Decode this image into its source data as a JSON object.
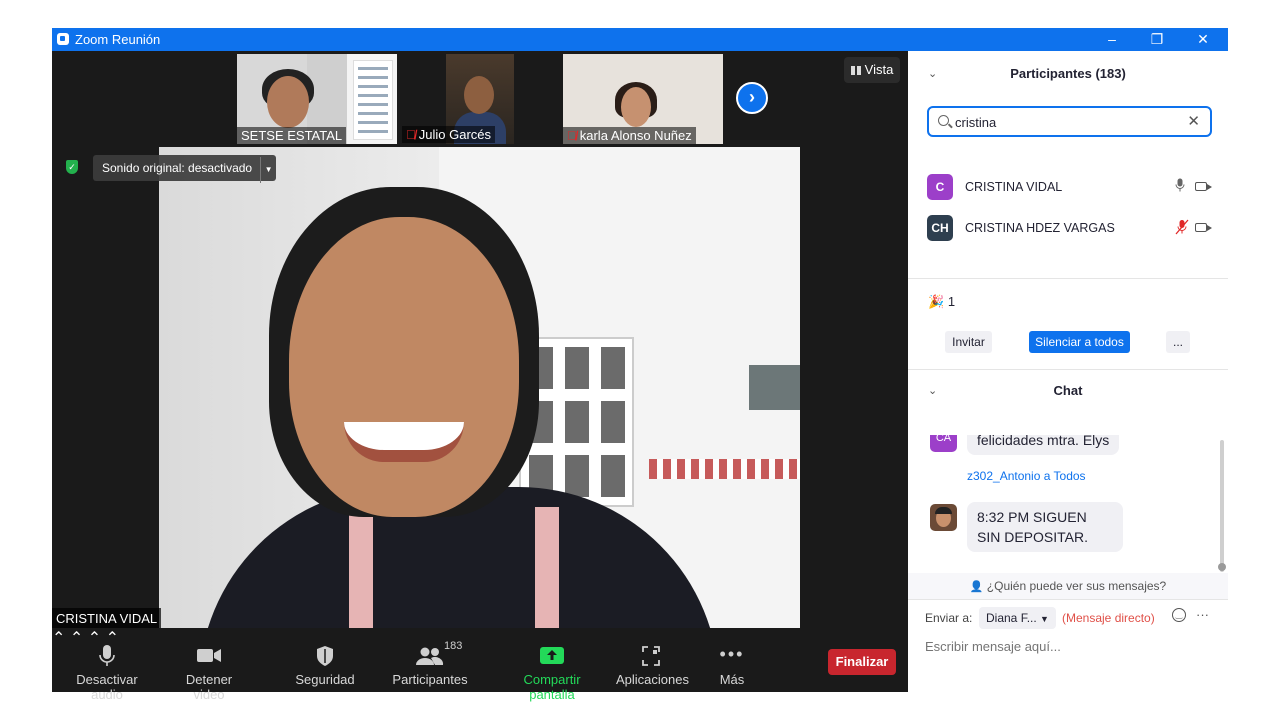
{
  "window": {
    "title": "Zoom Reunión",
    "controls": {
      "minimize": "–",
      "restore": "❐",
      "close": "✕"
    }
  },
  "thumbnails": [
    {
      "name": "SETSE ESTATAL",
      "muted": false
    },
    {
      "name": "Julio Garcés",
      "muted": true
    },
    {
      "name": "karla Alonso Nuñez",
      "muted": true
    }
  ],
  "view_button": "Vista",
  "sound_status": "Sonido original: desactivado",
  "active_speaker": "CRISTINA VIDAL",
  "toolbar": {
    "mute": "Desactivar audio",
    "video": "Detener video",
    "security": "Seguridad",
    "participants": "Participantes",
    "participants_count": "183",
    "share": "Compartir pantalla",
    "apps": "Aplicaciones",
    "more": "Más",
    "end": "Finalizar"
  },
  "participants_panel": {
    "title": "Participantes (183)",
    "search_value": "cristina",
    "results": [
      {
        "initials": "C",
        "name": "CRISTINA VIDAL",
        "avatar_color": "#9c3fc9",
        "mic_muted": false
      },
      {
        "initials": "CH",
        "name": "CRISTINA HDEZ VARGAS",
        "avatar_color": "#2e3f4f",
        "mic_muted": true
      }
    ],
    "reaction_count": "1",
    "invite": "Invitar",
    "mute_all": "Silenciar a todos",
    "more": "..."
  },
  "chat": {
    "title": "Chat",
    "messages": [
      {
        "avatar_initials": "CA",
        "avatar_color": "#9c3fc9",
        "sender": "",
        "text": "felicidades mtra. Elys"
      },
      {
        "avatar_initials": "",
        "sender": "z302_Antonio a Todos",
        "text": "8:32 PM SIGUEN SIN DEPOSITAR."
      }
    ],
    "privacy_note": "¿Quién puede ver sus mensajes?",
    "send_to_label": "Enviar a:",
    "send_to_value": "Diana F...",
    "direct_label": "(Mensaje directo)",
    "input_placeholder": "Escribir mensaje aquí..."
  },
  "colors": {
    "accent": "#0e72ed",
    "end_button": "#c8262e",
    "share_green": "#23d959",
    "muted_red": "#e02828"
  }
}
